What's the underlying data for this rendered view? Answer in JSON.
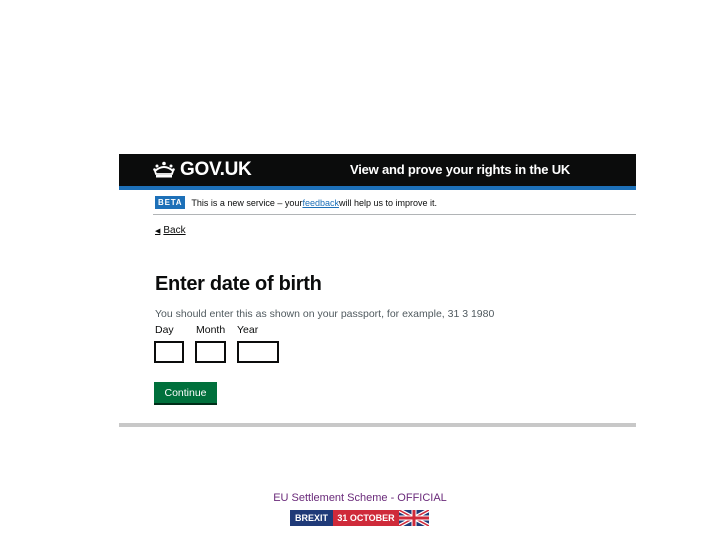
{
  "header": {
    "logo_text": "GOV.UK",
    "service_name": "View and prove your rights in the UK"
  },
  "phase_banner": {
    "tag": "BETA",
    "text_before": "This is a new service – your ",
    "link": "feedback",
    "text_after": " will help us to improve it."
  },
  "back_link": {
    "label": "Back",
    "icon": "chevron-left-icon"
  },
  "form": {
    "title": "Enter date of birth",
    "hint": "You should enter this as shown on your passport, for example, 31 3 1980",
    "fields": {
      "day": {
        "label": "Day",
        "value": ""
      },
      "month": {
        "label": "Month",
        "value": ""
      },
      "year": {
        "label": "Year",
        "value": ""
      }
    },
    "continue_label": "Continue"
  },
  "footer": {
    "classification": "EU Settlement Scheme - OFFICIAL",
    "banner_left": "BREXIT",
    "banner_right": "31 OCTOBER"
  },
  "colors": {
    "header_bg": "#0b0c0c",
    "accent_blue": "#1d70b8",
    "button_green": "#00703c",
    "footer_text": "#6a2a7a"
  }
}
